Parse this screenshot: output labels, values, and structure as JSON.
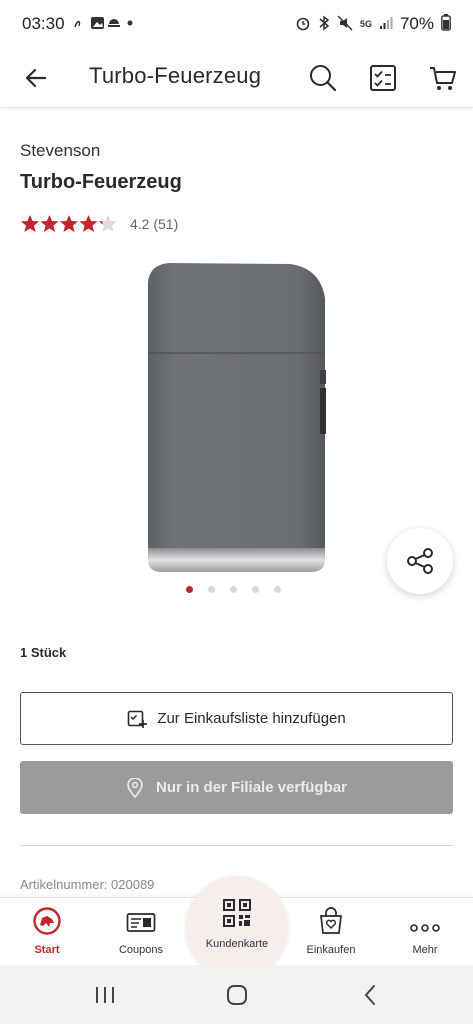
{
  "status_bar": {
    "time": "03:30",
    "battery": "70%",
    "network": "5G"
  },
  "app_bar": {
    "title": "Turbo-Feuerzeug"
  },
  "product": {
    "brand": "Stevenson",
    "name": "Turbo-Feuerzeug",
    "rating": 4.2,
    "rating_text": "4.2 (51)",
    "review_count": 51,
    "unit": "1 Stück",
    "image_count": 5,
    "active_image_index": 0,
    "article_number": "Artikelnummer: 020089"
  },
  "actions": {
    "shopping_list_label": "Zur Einkaufsliste hinzufügen",
    "store_only_label": "Nur in der Filiale verfügbar"
  },
  "bottom_nav": {
    "items": [
      {
        "label": "Start",
        "icon": "home-logo-icon",
        "active": true
      },
      {
        "label": "Coupons",
        "icon": "coupon-icon",
        "active": false
      },
      {
        "label": "Kundenkarte",
        "icon": "qr-code-icon",
        "active": false
      },
      {
        "label": "Einkaufen",
        "icon": "shopping-bag-icon",
        "active": false
      },
      {
        "label": "Mehr",
        "icon": "more-dots-icon",
        "active": false
      }
    ]
  },
  "colors": {
    "accent": "#c0272d",
    "disabled_button": "#9b9b9b",
    "product_body": "#6e7073"
  }
}
